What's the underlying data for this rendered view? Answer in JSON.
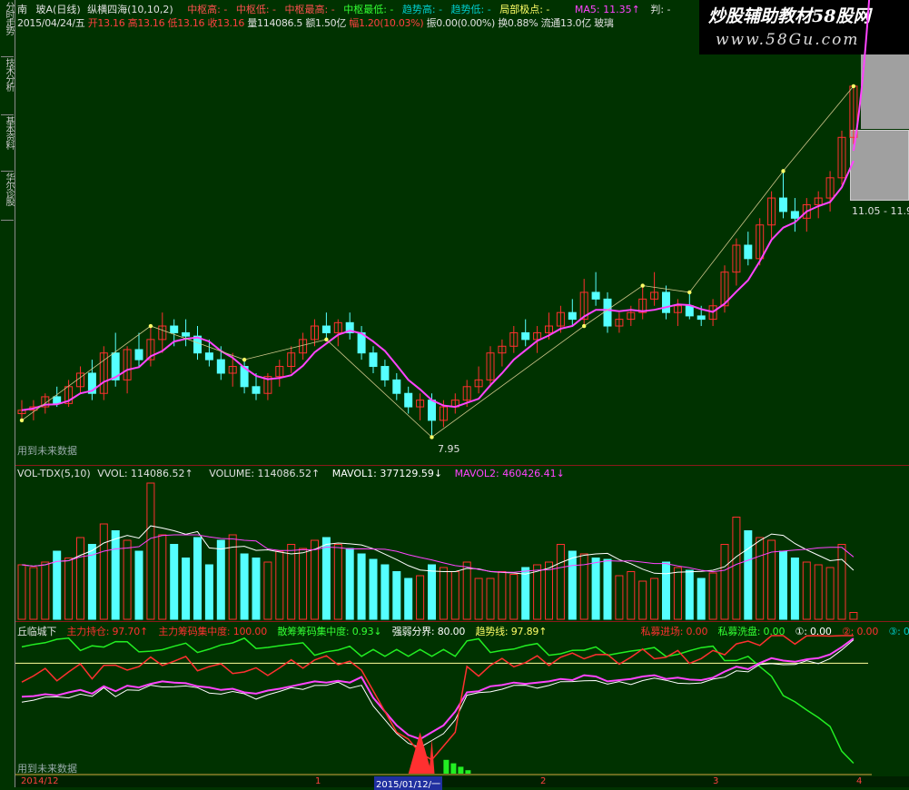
{
  "side_tabs": [
    "分时走势",
    "技术分析",
    "基本资料",
    "华尔诊股"
  ],
  "header": {
    "row1": [
      {
        "t": "南",
        "c": "#e0e0e0"
      },
      {
        "t": "玻A(日线)",
        "c": "#e0e0e0"
      },
      {
        "t": "纵横四海(10,10,2)",
        "c": "#e0e0e0"
      },
      {
        "t": "中枢高: -",
        "c": "#ff5050"
      },
      {
        "t": "中枢低: -",
        "c": "#ff5050"
      },
      {
        "t": "中枢最高: -",
        "c": "#ff5050"
      },
      {
        "t": "中枢最低: -",
        "c": "#33ff33"
      },
      {
        "t": "趋势高: -",
        "c": "#00cccc"
      },
      {
        "t": "趋势低: -",
        "c": "#00cccc"
      },
      {
        "t": "局部极点: -",
        "c": "#ffff66"
      },
      {
        "t": "MA5: 11.35↑",
        "c": "#ff44ff"
      },
      {
        "t": "判: -",
        "c": "#e0e0e0"
      }
    ],
    "row2": [
      {
        "t": "2015/04/24/五",
        "c": "#e0e0e0"
      },
      {
        "t": "开13.16",
        "c": "#ff4040"
      },
      {
        "t": "高13.16",
        "c": "#ff4040"
      },
      {
        "t": "低13.16",
        "c": "#ff4040"
      },
      {
        "t": "收13.16",
        "c": "#ff4040"
      },
      {
        "t": "量114086.5",
        "c": "#e0e0e0"
      },
      {
        "t": "额1.50亿",
        "c": "#e0e0e0"
      },
      {
        "t": "幅1.20(10.03%)",
        "c": "#ff4040"
      },
      {
        "t": "振0.00(0.00%)",
        "c": "#e0e0e0"
      },
      {
        "t": "换0.88%",
        "c": "#e0e0e0"
      },
      {
        "t": "流通13.0亿",
        "c": "#e0e0e0"
      },
      {
        "t": "玻璃",
        "c": "#e0e0e0"
      }
    ]
  },
  "brand": {
    "line1": "炒股辅助教材58股网",
    "line2": "www.58Gu.com"
  },
  "price_labels": {
    "high": "11.05 - 11.9",
    "low": "7.95",
    "future": "用到未来数据"
  },
  "vol_header": [
    {
      "t": "VOL-TDX(5,10)",
      "c": "#e0e0e0"
    },
    {
      "t": "VVOL: 114086.52↑",
      "c": "#e0e0e0"
    },
    {
      "t": "VOLUME: 114086.52↑",
      "c": "#e0e0e0"
    },
    {
      "t": "MAVOL1: 377129.59↓",
      "c": "#ffffff"
    },
    {
      "t": "MAVOL2: 460426.41↓",
      "c": "#ff44ff"
    }
  ],
  "ind_header": [
    {
      "t": "丘临城下",
      "c": "#e0e0e0"
    },
    {
      "t": "主力持仓: 97.70↑",
      "c": "#ff3030"
    },
    {
      "t": "主力筹码集中度: 100.00",
      "c": "#ff3030"
    },
    {
      "t": "散筹筹码集中度: 0.93↓",
      "c": "#33ff33"
    },
    {
      "t": "强弱分界: 80.00",
      "c": "#ffffff"
    },
    {
      "t": "趋势线: 97.89↑",
      "c": "#ffff66"
    },
    {
      "t": "私募进场: 0.00",
      "c": "#ff3030"
    },
    {
      "t": "私募洗盘: 0.00",
      "c": "#33ff33"
    },
    {
      "t": "①: 0.00",
      "c": "#ffffff"
    },
    {
      "t": "②: 0.00",
      "c": "#ff3030"
    },
    {
      "t": "③: 0.00",
      "c": "#00cccc"
    }
  ],
  "ind_future": "用到未来数据",
  "time_axis": [
    "2014/12",
    "1",
    "2015/01/12/一",
    "2",
    "3",
    "4"
  ],
  "colors": {
    "bg": "#003200",
    "up": "#ff3030",
    "down": "#55ffff",
    "green": "#22ee22",
    "ma": "#ff44ff",
    "white": "#ffffff",
    "grid": "#8a1a1a"
  },
  "chart_data": {
    "type": "candlestick",
    "candles": [
      [
        8.3,
        8.5,
        8.2,
        8.35
      ],
      [
        8.35,
        8.5,
        8.2,
        8.4
      ],
      [
        8.4,
        8.6,
        8.3,
        8.55
      ],
      [
        8.55,
        8.7,
        8.4,
        8.45
      ],
      [
        8.45,
        8.8,
        8.4,
        8.7
      ],
      [
        8.7,
        9.0,
        8.6,
        8.9
      ],
      [
        8.9,
        9.1,
        8.5,
        8.6
      ],
      [
        8.6,
        9.3,
        8.5,
        9.2
      ],
      [
        9.2,
        9.5,
        8.7,
        8.8
      ],
      [
        8.8,
        9.3,
        8.6,
        9.25
      ],
      [
        9.25,
        9.5,
        9.0,
        9.1
      ],
      [
        9.1,
        9.6,
        9.0,
        9.4
      ],
      [
        9.4,
        9.8,
        9.2,
        9.6
      ],
      [
        9.6,
        9.7,
        9.3,
        9.5
      ],
      [
        9.5,
        9.7,
        9.3,
        9.45
      ],
      [
        9.45,
        9.6,
        9.1,
        9.2
      ],
      [
        9.2,
        9.4,
        9.0,
        9.1
      ],
      [
        9.1,
        9.3,
        8.8,
        8.9
      ],
      [
        8.9,
        9.2,
        8.7,
        9.0
      ],
      [
        9.0,
        9.1,
        8.6,
        8.7
      ],
      [
        8.7,
        8.9,
        8.5,
        8.6
      ],
      [
        8.6,
        8.9,
        8.5,
        8.85
      ],
      [
        8.85,
        9.1,
        8.7,
        9.0
      ],
      [
        9.0,
        9.3,
        8.9,
        9.2
      ],
      [
        9.2,
        9.5,
        9.1,
        9.4
      ],
      [
        9.4,
        9.7,
        9.3,
        9.6
      ],
      [
        9.6,
        9.8,
        9.4,
        9.5
      ],
      [
        9.5,
        9.7,
        9.3,
        9.65
      ],
      [
        9.65,
        9.8,
        9.4,
        9.5
      ],
      [
        9.5,
        9.6,
        9.1,
        9.2
      ],
      [
        9.2,
        9.3,
        8.9,
        9.0
      ],
      [
        9.0,
        9.1,
        8.7,
        8.8
      ],
      [
        8.8,
        8.9,
        8.5,
        8.6
      ],
      [
        8.6,
        8.7,
        8.3,
        8.4
      ],
      [
        8.4,
        8.6,
        8.2,
        8.5
      ],
      [
        8.5,
        8.6,
        7.95,
        8.2
      ],
      [
        8.2,
        8.5,
        8.1,
        8.4
      ],
      [
        8.4,
        8.6,
        8.3,
        8.5
      ],
      [
        8.5,
        8.8,
        8.4,
        8.7
      ],
      [
        8.7,
        9.0,
        8.6,
        8.8
      ],
      [
        8.8,
        9.3,
        8.7,
        9.2
      ],
      [
        9.2,
        9.4,
        9.0,
        9.3
      ],
      [
        9.3,
        9.6,
        9.2,
        9.5
      ],
      [
        9.5,
        9.7,
        9.3,
        9.4
      ],
      [
        9.4,
        9.6,
        9.2,
        9.5
      ],
      [
        9.5,
        9.8,
        9.4,
        9.6
      ],
      [
        9.6,
        9.9,
        9.5,
        9.8
      ],
      [
        9.8,
        10.0,
        9.6,
        9.7
      ],
      [
        9.7,
        10.3,
        9.6,
        10.1
      ],
      [
        10.1,
        10.4,
        9.9,
        10.0
      ],
      [
        10.0,
        10.1,
        9.5,
        9.6
      ],
      [
        9.6,
        9.8,
        9.5,
        9.7
      ],
      [
        9.7,
        9.9,
        9.6,
        9.8
      ],
      [
        9.8,
        10.2,
        9.7,
        10.0
      ],
      [
        10.0,
        10.4,
        9.9,
        10.1
      ],
      [
        10.1,
        10.2,
        9.7,
        9.8
      ],
      [
        9.8,
        10.0,
        9.6,
        9.9
      ],
      [
        9.9,
        10.1,
        9.7,
        9.75
      ],
      [
        9.75,
        9.9,
        9.6,
        9.7
      ],
      [
        9.7,
        10.0,
        9.6,
        9.9
      ],
      [
        9.9,
        10.5,
        9.8,
        10.4
      ],
      [
        10.4,
        10.9,
        10.2,
        10.8
      ],
      [
        10.8,
        11.0,
        10.5,
        10.6
      ],
      [
        10.6,
        11.2,
        10.5,
        11.1
      ],
      [
        11.1,
        11.6,
        10.9,
        11.5
      ],
      [
        11.5,
        11.9,
        11.2,
        11.3
      ],
      [
        11.3,
        11.5,
        11.0,
        11.2
      ],
      [
        11.2,
        11.5,
        11.0,
        11.4
      ],
      [
        11.4,
        11.6,
        11.2,
        11.5
      ],
      [
        11.5,
        11.9,
        11.3,
        11.8
      ],
      [
        11.8,
        12.5,
        11.7,
        12.4
      ],
      [
        12.4,
        13.16,
        12.3,
        13.16
      ]
    ],
    "ylim": [
      7.7,
      13.9
    ],
    "volumes": [
      0.4,
      0.38,
      0.42,
      0.5,
      0.45,
      0.6,
      0.55,
      0.7,
      0.65,
      0.58,
      0.5,
      1.0,
      0.62,
      0.55,
      0.45,
      0.6,
      0.4,
      0.58,
      0.62,
      0.48,
      0.45,
      0.42,
      0.5,
      0.55,
      0.52,
      0.58,
      0.6,
      0.55,
      0.52,
      0.48,
      0.44,
      0.4,
      0.35,
      0.3,
      0.32,
      0.4,
      0.38,
      0.35,
      0.42,
      0.3,
      0.3,
      0.35,
      0.33,
      0.38,
      0.4,
      0.42,
      0.55,
      0.5,
      0.48,
      0.45,
      0.44,
      0.32,
      0.35,
      0.28,
      0.3,
      0.42,
      0.38,
      0.36,
      0.3,
      0.34,
      0.55,
      0.75,
      0.65,
      0.6,
      0.58,
      0.5,
      0.45,
      0.42,
      0.4,
      0.38,
      0.55,
      0.05
    ]
  }
}
